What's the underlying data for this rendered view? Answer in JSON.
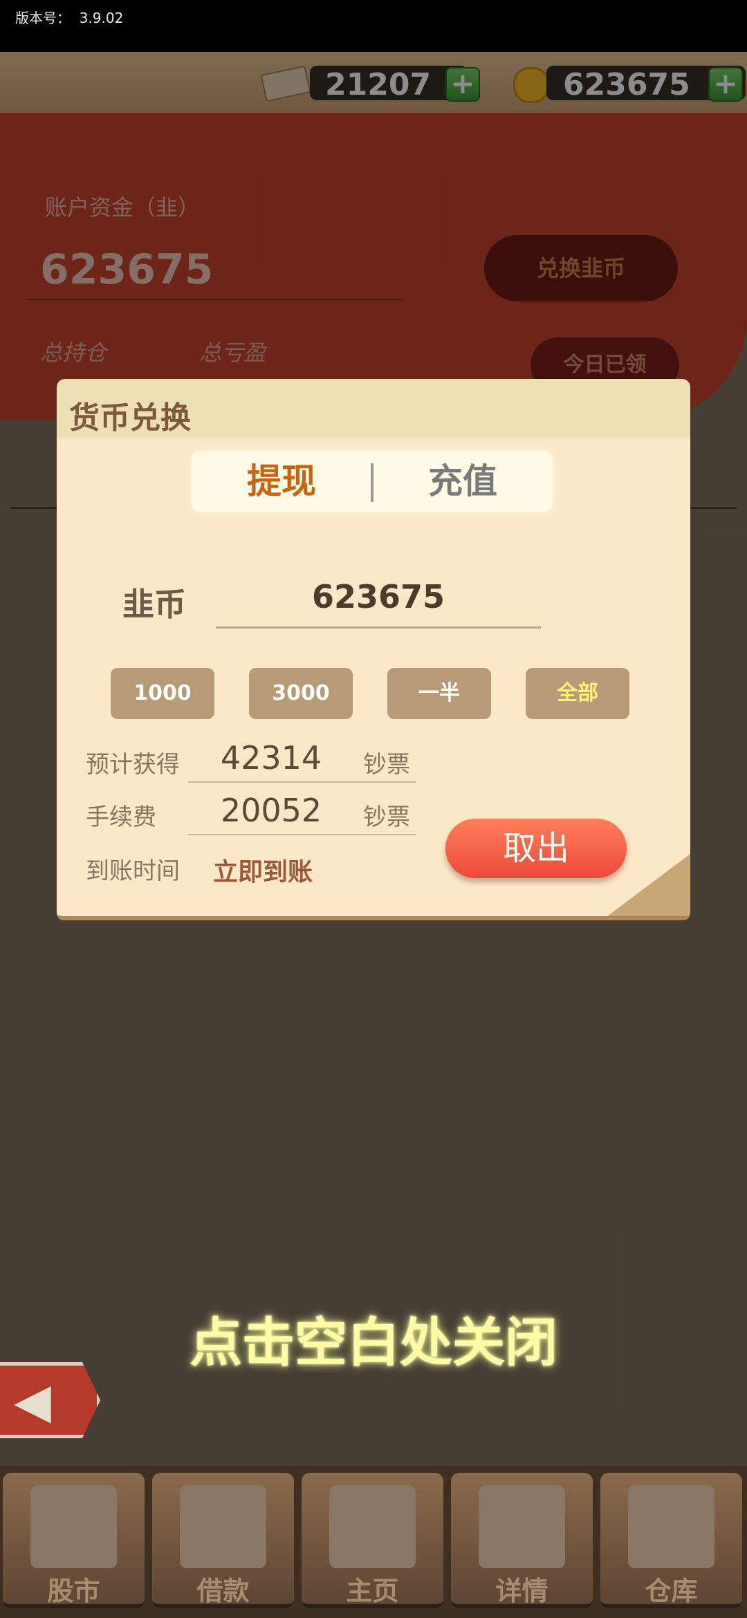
{
  "status": {
    "version_label": "版本号：",
    "version": "3.9.02"
  },
  "currency": {
    "cash": "21207",
    "coins": "623675",
    "plus": "+"
  },
  "account": {
    "label": "账户资金（韭）",
    "value": "623675",
    "exchange_button": "兑换韭币",
    "claim_button": "今日已领",
    "total_position": "总持仓",
    "total_pnl": "总亏盈"
  },
  "modal": {
    "title": "货币兑换",
    "tabs": [
      "提现",
      "充值"
    ],
    "coin_label": "韭币",
    "amount": "623675",
    "quick_buttons": [
      "1000",
      "3000",
      "一半",
      "全部"
    ],
    "rows": [
      {
        "label": "预计获得",
        "value": "42314",
        "unit": "钞票"
      },
      {
        "label": "手续费",
        "value": "20052",
        "unit": "钞票"
      }
    ],
    "arrival_label": "到账时间",
    "arrival_value": "立即到账",
    "withdraw_button": "取出"
  },
  "close_hint": "点击空白处关闭",
  "nav": [
    "股市",
    "借款",
    "主页",
    "详情",
    "仓库"
  ],
  "colors": {
    "accent_red": "#c8442f",
    "withdraw_orange": "#ff6b4a",
    "cream": "#fbe8c8"
  }
}
